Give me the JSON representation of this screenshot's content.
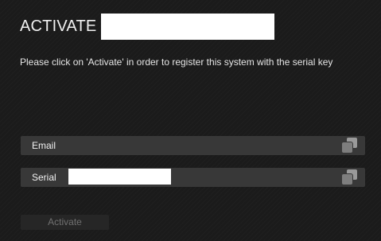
{
  "header": {
    "title": "ACTIVATE"
  },
  "description": "Please click on 'Activate' in order to register this system with the serial key",
  "fields": {
    "email": {
      "label": "Email",
      "value": "",
      "icon": "copy-icon"
    },
    "serial": {
      "label": "Serial",
      "value": "",
      "icon": "copy-icon"
    }
  },
  "actions": {
    "activate_label": "Activate"
  },
  "colors": {
    "background": "#1b1b1b",
    "field_background": "#383838",
    "button_background": "#262626",
    "button_text": "#707070",
    "text": "#e8e8e8"
  }
}
